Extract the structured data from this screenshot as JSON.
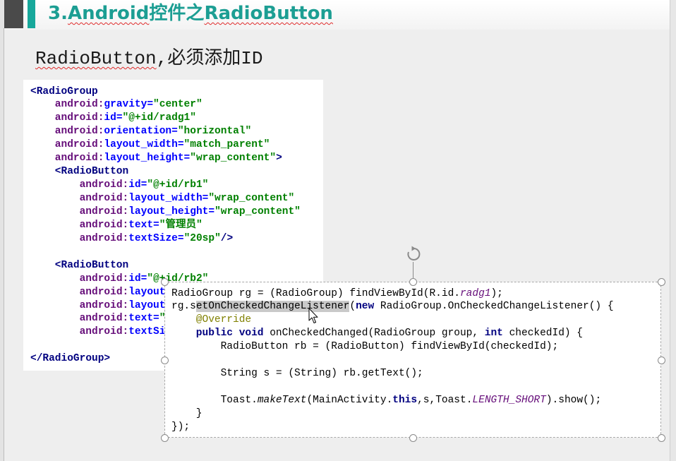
{
  "colors": {
    "accent_bar": "#17a89b",
    "title_text": "#1c9e93",
    "spell_check_underline": "#e02b2b"
  },
  "icons": {
    "rotate_handle": "rotate-icon",
    "cursor": "arrow-cursor-icon"
  },
  "slide": {
    "title": [
      {
        "text": "3.",
        "spell_error": false
      },
      {
        "text": "Android",
        "spell_error": true
      },
      {
        "text": "控件之",
        "spell_error": false
      },
      {
        "text": "RadioButton",
        "spell_error": true
      }
    ],
    "subtitle": [
      {
        "text": "RadioButton",
        "spell_error": true
      },
      {
        "text": ",必须添加ID",
        "spell_error": false
      }
    ],
    "xml_code": [
      {
        "indent": 0,
        "tokens": [
          [
            "<RadioGroup",
            "#000080"
          ]
        ]
      },
      {
        "indent": 4,
        "tokens": [
          [
            "android:",
            "#660e7a"
          ],
          [
            "gravity=",
            "#0000ff"
          ],
          [
            "\"center\"",
            "#008000"
          ]
        ]
      },
      {
        "indent": 4,
        "tokens": [
          [
            "android:",
            "#660e7a"
          ],
          [
            "id=",
            "#0000ff"
          ],
          [
            "\"@+id/radg1\"",
            "#008000"
          ]
        ]
      },
      {
        "indent": 4,
        "tokens": [
          [
            "android:",
            "#660e7a"
          ],
          [
            "orientation=",
            "#0000ff"
          ],
          [
            "\"horizontal\"",
            "#008000"
          ]
        ]
      },
      {
        "indent": 4,
        "tokens": [
          [
            "android:",
            "#660e7a"
          ],
          [
            "layout_width=",
            "#0000ff"
          ],
          [
            "\"match_parent\"",
            "#008000"
          ]
        ]
      },
      {
        "indent": 4,
        "tokens": [
          [
            "android:",
            "#660e7a"
          ],
          [
            "layout_height=",
            "#0000ff"
          ],
          [
            "\"wrap_content\"",
            "#008000"
          ],
          [
            ">",
            "#000080"
          ]
        ]
      },
      {
        "indent": 4,
        "tokens": [
          [
            "<RadioButton",
            "#000080"
          ]
        ]
      },
      {
        "indent": 8,
        "tokens": [
          [
            "android:",
            "#660e7a"
          ],
          [
            "id=",
            "#0000ff"
          ],
          [
            "\"@+id/rb1\"",
            "#008000"
          ]
        ]
      },
      {
        "indent": 8,
        "tokens": [
          [
            "android:",
            "#660e7a"
          ],
          [
            "layout_width=",
            "#0000ff"
          ],
          [
            "\"wrap_content\"",
            "#008000"
          ]
        ]
      },
      {
        "indent": 8,
        "tokens": [
          [
            "android:",
            "#660e7a"
          ],
          [
            "layout_height=",
            "#0000ff"
          ],
          [
            "\"wrap_content\"",
            "#008000"
          ]
        ]
      },
      {
        "indent": 8,
        "tokens": [
          [
            "android:",
            "#660e7a"
          ],
          [
            "text=",
            "#0000ff"
          ],
          [
            "\"管理员\"",
            "#008000"
          ]
        ]
      },
      {
        "indent": 8,
        "tokens": [
          [
            "android:",
            "#660e7a"
          ],
          [
            "textSize=",
            "#0000ff"
          ],
          [
            "\"20sp\"",
            "#008000"
          ],
          [
            "/>",
            "#000080"
          ]
        ]
      },
      {
        "indent": 0,
        "tokens": []
      },
      {
        "indent": 4,
        "tokens": [
          [
            "<RadioButton",
            "#000080"
          ]
        ]
      },
      {
        "indent": 8,
        "tokens": [
          [
            "android:",
            "#660e7a"
          ],
          [
            "id=",
            "#0000ff"
          ],
          [
            "\"@+id/rb2\"",
            "#008000"
          ]
        ]
      },
      {
        "indent": 8,
        "tokens": [
          [
            "android:",
            "#660e7a"
          ],
          [
            "layout",
            "#0000ff"
          ]
        ]
      },
      {
        "indent": 8,
        "tokens": [
          [
            "android:",
            "#660e7a"
          ],
          [
            "layout",
            "#0000ff"
          ]
        ]
      },
      {
        "indent": 8,
        "tokens": [
          [
            "android:",
            "#660e7a"
          ],
          [
            "text=",
            "#0000ff"
          ],
          [
            "\"",
            "#008000"
          ]
        ]
      },
      {
        "indent": 8,
        "tokens": [
          [
            "android:",
            "#660e7a"
          ],
          [
            "textSi",
            "#0000ff"
          ]
        ]
      },
      {
        "indent": 0,
        "tokens": []
      },
      {
        "indent": 0,
        "tokens": [
          [
            "</RadioGroup>",
            "#000080"
          ]
        ]
      }
    ],
    "java_code": [
      {
        "indent": 0,
        "tokens": [
          [
            "RadioGroup rg = (RadioGroup) findViewById(R.id.",
            "#000000"
          ],
          [
            "radg1",
            "#660e7a",
            false,
            true
          ],
          [
            ");",
            "#000000"
          ]
        ]
      },
      {
        "indent": 0,
        "tokens": [
          [
            "rg.s",
            "#000000"
          ],
          [
            "etOnCheckedChangeListener",
            "#000000",
            false,
            false,
            "#c9c9c9"
          ],
          [
            "(",
            "#000000"
          ],
          [
            "new",
            "#000080",
            true
          ],
          [
            " RadioGroup.OnCheckedChangeListener() {",
            "#000000"
          ]
        ]
      },
      {
        "indent": 4,
        "tokens": [
          [
            "@Override",
            "#808000"
          ]
        ]
      },
      {
        "indent": 4,
        "tokens": [
          [
            "public void",
            "#000080",
            true
          ],
          [
            " onCheckedChanged(RadioGroup group, ",
            "#000000"
          ],
          [
            "int",
            "#000080",
            true
          ],
          [
            " checkedId) {",
            "#000000"
          ]
        ]
      },
      {
        "indent": 8,
        "tokens": [
          [
            "RadioButton rb = (RadioButton) findViewById(checkedId);",
            "#000000"
          ]
        ]
      },
      {
        "indent": 0,
        "tokens": []
      },
      {
        "indent": 8,
        "tokens": [
          [
            "String s = (String) rb.getText();",
            "#000000"
          ]
        ]
      },
      {
        "indent": 0,
        "tokens": []
      },
      {
        "indent": 8,
        "tokens": [
          [
            "Toast.",
            "#000000"
          ],
          [
            "makeText",
            "#000000",
            false,
            true
          ],
          [
            "(MainActivity.",
            "#000000"
          ],
          [
            "this",
            "#000080",
            true
          ],
          [
            ",s,Toast.",
            "#000000"
          ],
          [
            "LENGTH_SHORT",
            "#660e7a",
            false,
            true
          ],
          [
            ").show();",
            "#000000"
          ]
        ]
      },
      {
        "indent": 4,
        "tokens": [
          [
            "}",
            "#000000"
          ]
        ]
      },
      {
        "indent": 0,
        "tokens": [
          [
            "});",
            "#000000"
          ]
        ]
      }
    ]
  }
}
